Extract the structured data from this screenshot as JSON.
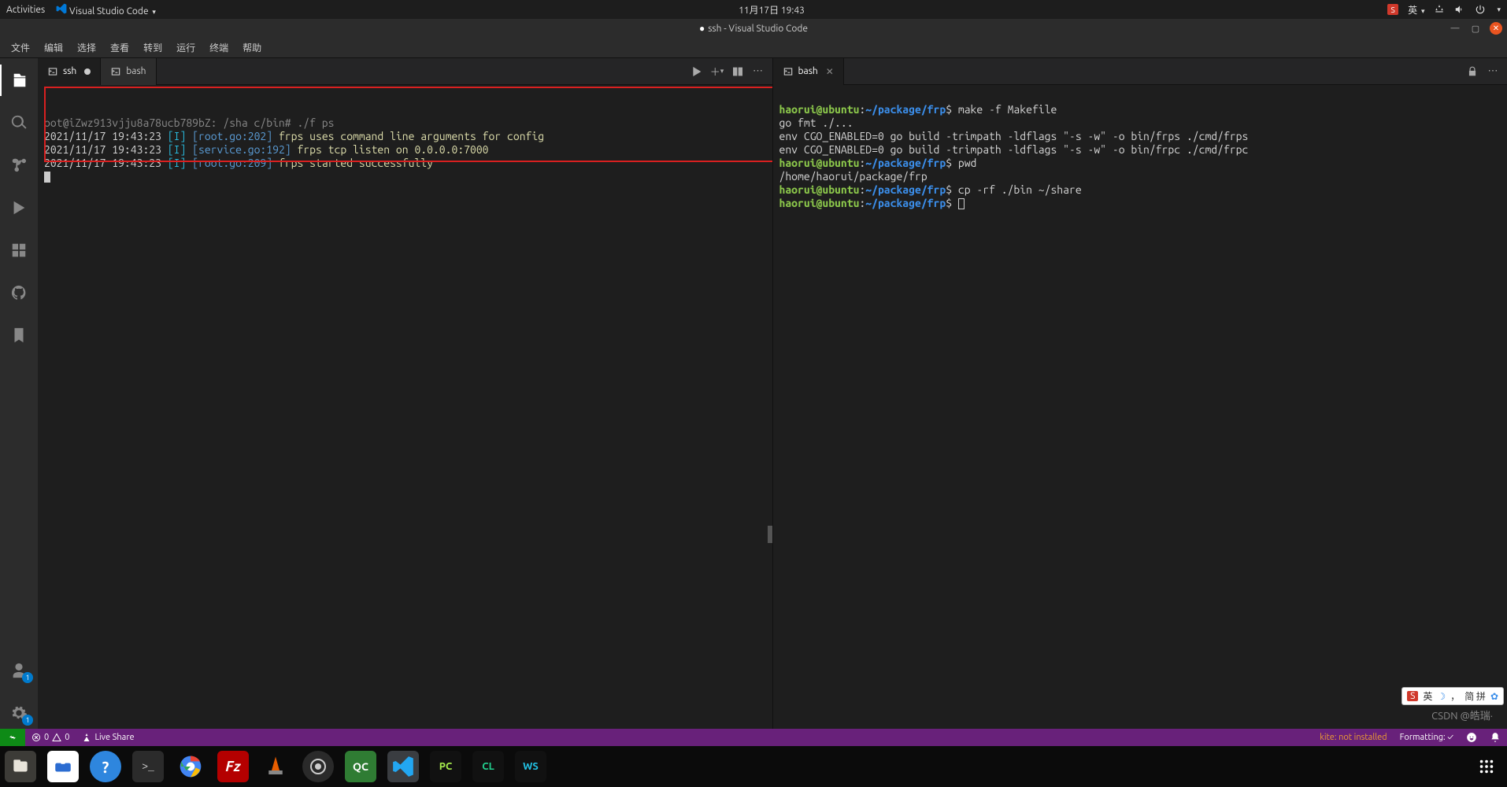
{
  "topbar": {
    "activities": "Activities",
    "app": "Visual Studio Code",
    "datetime": "11月17日 19:43",
    "ime_indicator": "英"
  },
  "titlebar": {
    "title": "ssh - Visual Studio Code"
  },
  "menubar": {
    "items": [
      "文件",
      "编辑",
      "选择",
      "查看",
      "转到",
      "运行",
      "终端",
      "帮助"
    ]
  },
  "activitybar": {
    "account_badge": "1",
    "settings_badge": "1"
  },
  "left_pane": {
    "tabs": [
      {
        "label": "ssh",
        "active": true,
        "dirty": true
      },
      {
        "label": "bash",
        "active": false,
        "dirty": false
      }
    ],
    "terminal": {
      "prompt_line": "oot@iZwz913vjju8a78ucb789bZ: /sha c/bin# ./f ps",
      "log_lines": [
        {
          "ts": "2021/11/17 19:43:23",
          "level": "[I]",
          "src": "[root.go:202]",
          "msg": "frps uses command line arguments for config"
        },
        {
          "ts": "2021/11/17 19:43:23",
          "level": "[I]",
          "src": "[service.go:192]",
          "msg": "frps tcp listen on 0.0.0.0:7000"
        },
        {
          "ts": "2021/11/17 19:43:23",
          "level": "[I]",
          "src": "[root.go:209]",
          "msg": "frps started successfully"
        }
      ]
    }
  },
  "right_pane": {
    "tabs": [
      {
        "label": "bash",
        "active": true
      }
    ],
    "terminal": {
      "lines": [
        {
          "user": "haorui@ubuntu",
          "sep": ":",
          "path": "~/package/frp",
          "dollar": "$",
          "cmd": " make -f Makefile"
        },
        {
          "plain": "go fmt ./..."
        },
        {
          "plain": "env CGO_ENABLED=0 go build -trimpath -ldflags \"-s -w\" -o bin/frps ./cmd/frps"
        },
        {
          "plain": "env CGO_ENABLED=0 go build -trimpath -ldflags \"-s -w\" -o bin/frpc ./cmd/frpc"
        },
        {
          "user": "haorui@ubuntu",
          "sep": ":",
          "path": "~/package/frp",
          "dollar": "$",
          "cmd": " pwd"
        },
        {
          "plain": "/home/haorui/package/frp"
        },
        {
          "user": "haorui@ubuntu",
          "sep": ":",
          "path": "~/package/frp",
          "dollar": "$",
          "cmd": " cp -rf ./bin ~/share"
        },
        {
          "user": "haorui@ubuntu",
          "sep": ":",
          "path": "~/package/frp",
          "dollar": "$",
          "cmd": " ",
          "cursor": true
        }
      ]
    }
  },
  "statusbar": {
    "errors": "0",
    "warnings": "0",
    "live_share": "Live Share",
    "kite": "kite: not installed",
    "formatting": "Formatting: ✓"
  },
  "ime_popup": {
    "brand": "S",
    "lang": "英",
    "mode": "简 拼"
  },
  "watermark": "CSDN @皓瑞·"
}
